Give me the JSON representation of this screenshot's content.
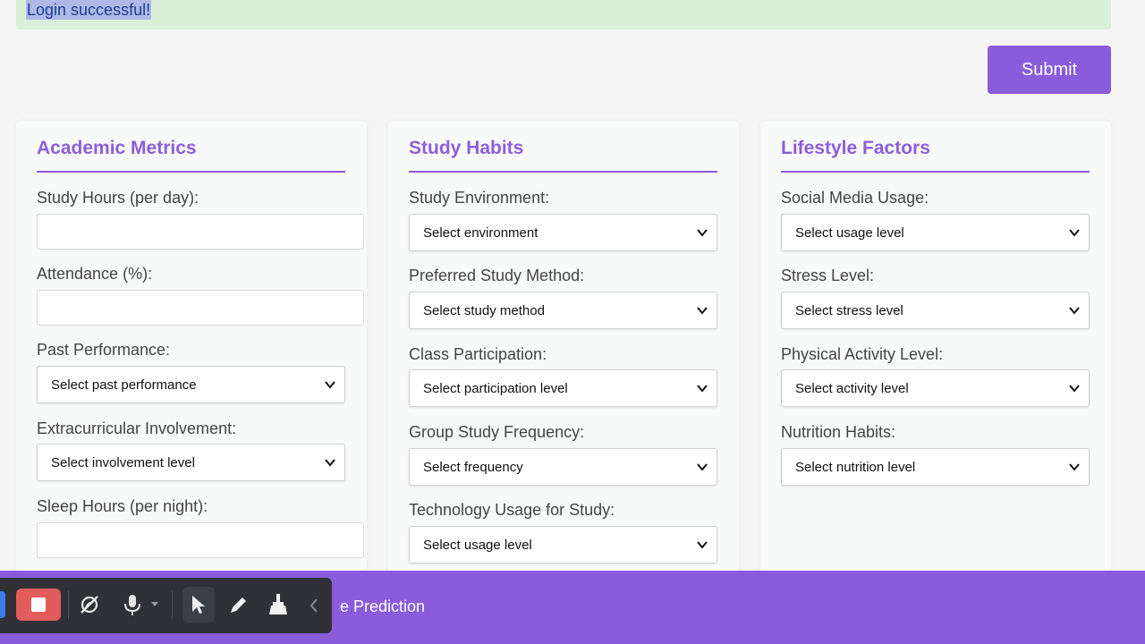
{
  "alert": {
    "message": "Login successful!"
  },
  "actions": {
    "submit_label": "Submit"
  },
  "sections": {
    "academic": {
      "title": "Academic Metrics",
      "study_hours_label": "Study Hours (per day):",
      "attendance_label": "Attendance (%):",
      "past_performance_label": "Past Performance:",
      "past_performance_value": "Select past performance",
      "extracurricular_label": "Extracurricular Involvement:",
      "extracurricular_value": "Select involvement level",
      "sleep_hours_label": "Sleep Hours (per night):"
    },
    "habits": {
      "title": "Study Habits",
      "environment_label": "Study Environment:",
      "environment_value": "Select environment",
      "method_label": "Preferred Study Method:",
      "method_value": "Select study method",
      "participation_label": "Class Participation:",
      "participation_value": "Select participation level",
      "group_label": "Group Study Frequency:",
      "group_value": "Select frequency",
      "tech_label": "Technology Usage for Study:",
      "tech_value": "Select usage level"
    },
    "lifestyle": {
      "title": "Lifestyle Factors",
      "social_label": "Social Media Usage:",
      "social_value": "Select usage level",
      "stress_label": "Stress Level:",
      "stress_value": "Select stress level",
      "activity_label": "Physical Activity Level:",
      "activity_value": "Select activity level",
      "nutrition_label": "Nutrition Habits:",
      "nutrition_value": "Select nutrition level"
    }
  },
  "bottom_bar": {
    "partial_label": "e Prediction"
  },
  "recording_toolbar": {
    "icons": [
      "stop-icon",
      "camera-off-icon",
      "microphone-icon",
      "dropdown-caret-icon",
      "cursor-arrow-icon",
      "pen-icon",
      "broom-icon",
      "collapse-chevron-icon"
    ]
  },
  "colors": {
    "accent": "#8a5cdb",
    "alert_bg": "#d9f0d9",
    "toolbar_bg": "#2f3136",
    "stop_red": "#e25c5c"
  }
}
